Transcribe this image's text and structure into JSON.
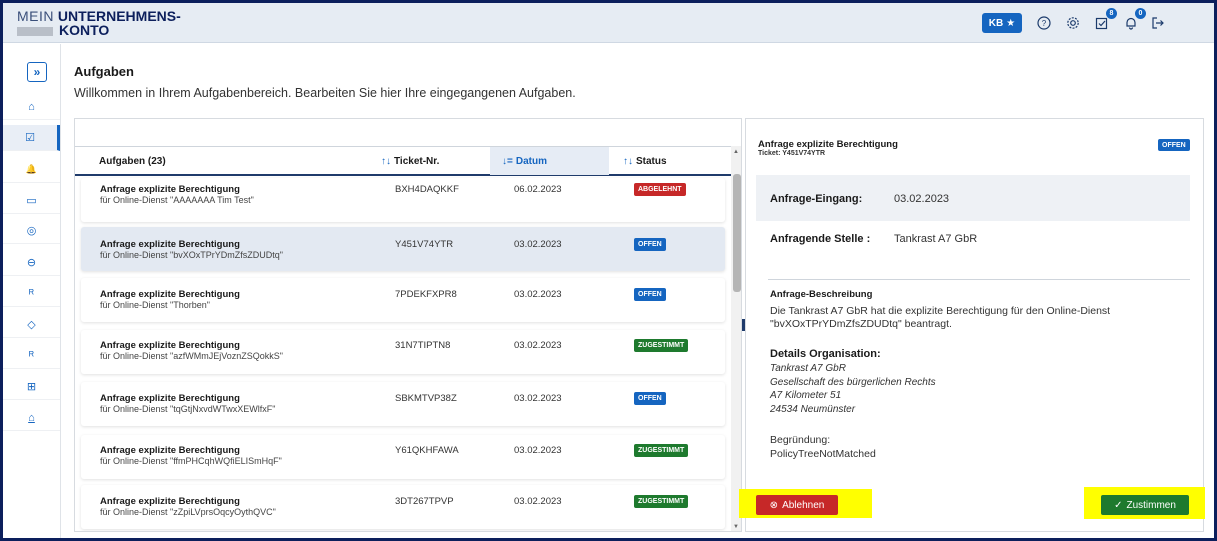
{
  "header": {
    "logo_mein": "MEIN",
    "logo_unternehmens": "UNTERNEHMENS-",
    "logo_konto": "KONTO",
    "user_initials": "KB",
    "tasks_badge": "8",
    "notifications_badge": "0",
    "accent": "#1565c0"
  },
  "sidebar": {
    "toggle_glyph": "»",
    "items": [
      {
        "icon": "home-icon",
        "glyph": "⌂"
      },
      {
        "icon": "tasks-icon",
        "glyph": "☑"
      },
      {
        "icon": "bell-icon",
        "glyph": "🔔"
      },
      {
        "icon": "card-icon",
        "glyph": "▭"
      },
      {
        "icon": "compass-icon",
        "glyph": "◎"
      },
      {
        "icon": "inbox-icon",
        "glyph": "⊖"
      },
      {
        "icon": "users-icon",
        "glyph": "ᴿ"
      },
      {
        "icon": "tag-icon",
        "glyph": "◇"
      },
      {
        "icon": "group-icon",
        "glyph": "ᴿ"
      },
      {
        "icon": "grid-icon",
        "glyph": "⊞"
      },
      {
        "icon": "bank-icon",
        "glyph": "⌂"
      }
    ]
  },
  "page": {
    "title": "Aufgaben",
    "subtitle": "Willkommen in Ihrem Aufgabenbereich. Bearbeiten Sie hier Ihre eingegangenen Aufgaben."
  },
  "list": {
    "columns": {
      "tasks": "Aufgaben (23)",
      "ticket": "Ticket-Nr.",
      "date": "Datum",
      "status": "Status"
    },
    "rows": [
      {
        "title": "Anfrage explizite Berechtigung",
        "sub": "für Online-Dienst \"AAAAAAA Tim Test\"",
        "ticket": "BXH4DAQKKF",
        "date": "06.02.2023",
        "status": "ABGELEHNT",
        "status_color": "#c62828"
      },
      {
        "title": "Anfrage explizite Berechtigung",
        "sub": "für Online-Dienst \"bvXOxTPrYDmZfsZDUDtq\"",
        "ticket": "Y451V74YTR",
        "date": "03.02.2023",
        "status": "OFFEN",
        "status_color": "#1565c0"
      },
      {
        "title": "Anfrage explizite Berechtigung",
        "sub": "für Online-Dienst \"Thorben\"",
        "ticket": "7PDEKFXPR8",
        "date": "03.02.2023",
        "status": "OFFEN",
        "status_color": "#1565c0"
      },
      {
        "title": "Anfrage explizite Berechtigung",
        "sub": "für Online-Dienst \"azfWMmJEjVoznZSQokkS\"",
        "ticket": "31N7TIPTN8",
        "date": "03.02.2023",
        "status": "ZUGESTIMMT",
        "status_color": "#1e7a2e"
      },
      {
        "title": "Anfrage explizite Berechtigung",
        "sub": "für Online-Dienst \"tqGtjNxvdWTwxXEWlfxF\"",
        "ticket": "SBKMTVP38Z",
        "date": "03.02.2023",
        "status": "OFFEN",
        "status_color": "#1565c0"
      },
      {
        "title": "Anfrage explizite Berechtigung",
        "sub": "für Online-Dienst \"ffmPHCqhWQfiELISmHqF\"",
        "ticket": "Y61QKHFAWA",
        "date": "03.02.2023",
        "status": "ZUGESTIMMT",
        "status_color": "#1e7a2e"
      },
      {
        "title": "Anfrage explizite Berechtigung",
        "sub": "für Online-Dienst \"zZpiLVprsOqcyOythQVC\"",
        "ticket": "3DT267TPVP",
        "date": "03.02.2023",
        "status": "ZUGESTIMMT",
        "status_color": "#1e7a2e"
      }
    ]
  },
  "detail": {
    "title": "Anfrage explizite Berechtigung",
    "ticket": "Ticket: Y451V74YTR",
    "status": "OFFEN",
    "eingang_label": "Anfrage-Eingang:",
    "eingang_value": "03.02.2023",
    "stelle_label": "Anfragende Stelle :",
    "stelle_value": "Tankrast A7 GbR",
    "desc_heading": "Anfrage-Beschreibung",
    "desc_text": "Die Tankrast A7 GbR hat die explizite Berechtigung für den Online-Dienst \"bvXOxTPrYDmZfsZDUDtq\" beantragt.",
    "org_heading": "Details Organisation:",
    "org_line1": "Tankrast A7 GbR",
    "org_line2": "Gesellschaft des bürgerlichen Rechts",
    "org_line3": "A7 Kilometer 51",
    "org_line4": "24534 Neumünster",
    "reason_label": "Begründung:",
    "reason_value": "PolicyTreeNotMatched",
    "reject_label": "Ablehnen",
    "accept_label": "Zustimmen"
  }
}
